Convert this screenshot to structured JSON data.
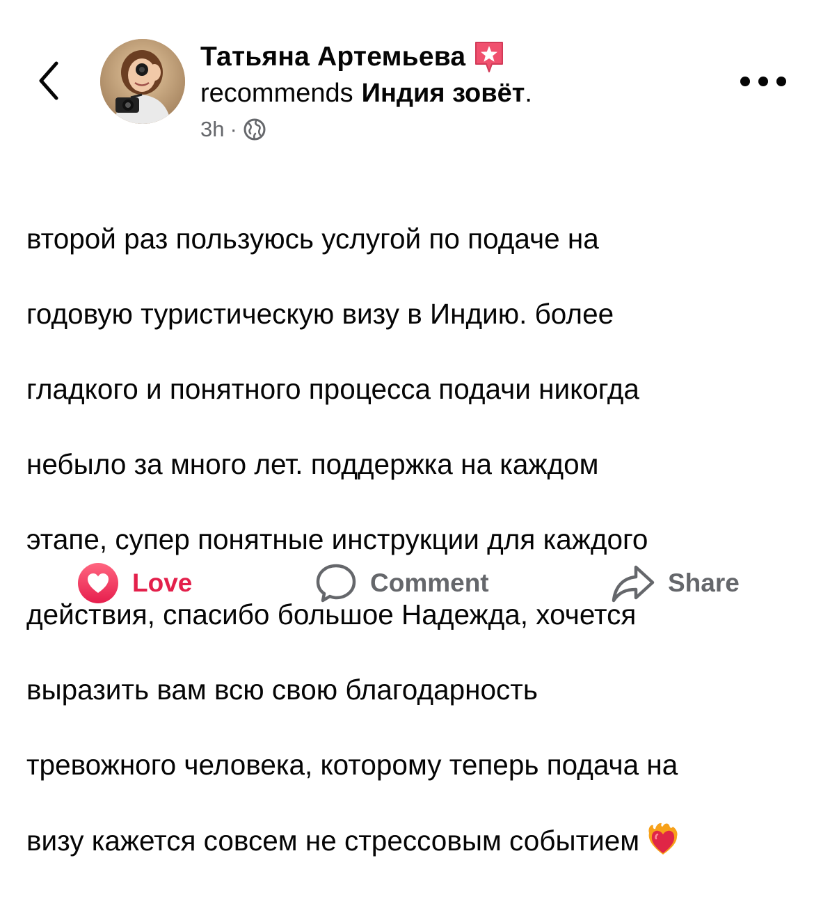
{
  "header": {
    "back_icon": "chevron-left-icon",
    "author_name": "Татьяна Артемьева",
    "badge_icon": "star-badge-icon",
    "action_verb": "recommends",
    "page_name": "Индия зовёт",
    "page_suffix": ".",
    "timestamp": "3h",
    "separator": "·",
    "privacy_icon": "globe-icon",
    "more_icon": "more-options-icon"
  },
  "post": {
    "lines": [
      "второй раз пользуюсь услугой по подаче на",
      "годовую туристическую визу в Индию. более",
      "гладкого и понятного процесса подачи никогда",
      "небыло за много лет. поддержка на каждом",
      "этапе, супер понятные инструкции для каждого",
      "действия, спасибо большое Надежда, хочется",
      "выразить вам всю свою благодарность",
      "тревожного человека, которому теперь подача на",
      "визу кажется совсем не стрессовым событием"
    ],
    "emoji": "heart-on-fire-icon"
  },
  "actions": {
    "love_label": "Love",
    "comment_label": "Comment",
    "share_label": "Share"
  },
  "colors": {
    "love": "#e3204b",
    "secondary_text": "#65676b",
    "primary_text": "#050505",
    "badge": "#f0506e"
  }
}
